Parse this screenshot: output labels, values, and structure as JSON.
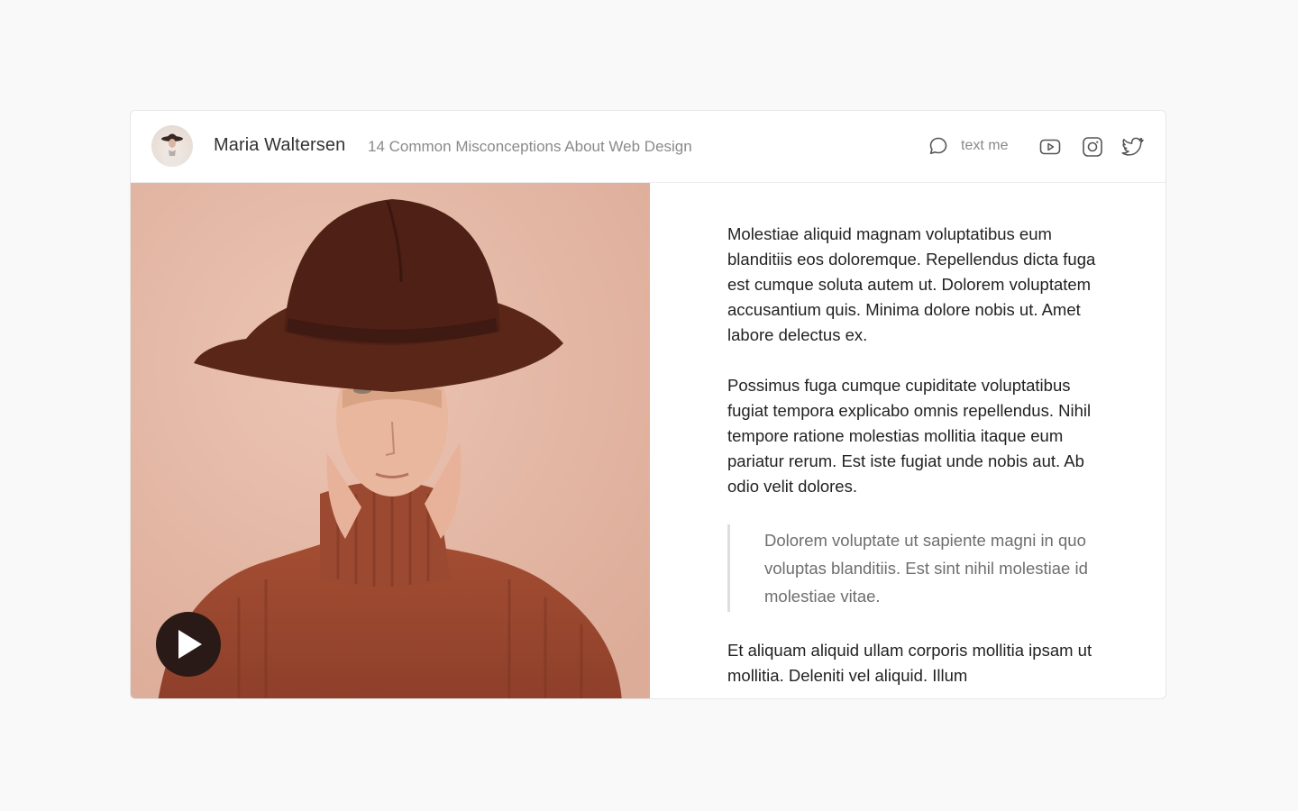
{
  "header": {
    "author_name": "Maria Waltersen",
    "post_title": "14 Common Misconceptions About Web Design",
    "text_me_label": "text me"
  },
  "icons": {
    "chat": "chat-bubble-icon",
    "youtube": "youtube-icon",
    "instagram": "instagram-icon",
    "twitter": "twitter-icon",
    "play": "play-icon"
  },
  "article": {
    "paragraphs": [
      "Molestiae aliquid magnam voluptatibus eum blanditiis eos doloremque. Repellendus dicta fuga est cumque soluta autem ut. Dolorem voluptatem accusantium quis. Minima dolore nobis ut. Amet labore delectus ex.",
      "Possimus fuga cumque cupiditate voluptatibus fugiat tempora explicabo omnis repellendus. Nihil tempore ratione molestias mollitia itaque eum pariatur rerum. Est iste fugiat unde nobis aut. Ab odio velit dolores."
    ],
    "quote": "Dolorem voluptate ut sapiente magni in quo voluptas blanditiis. Est sint nihil molestiae id molestiae vitae.",
    "after_quote": "Et aliquam aliquid ullam corporis mollitia ipsam ut mollitia. Deleniti vel aliquid. Illum"
  },
  "colors": {
    "page_background": "#f9f9f9",
    "card_background": "#ffffff",
    "photo_background": "#e6b8a4",
    "play_button": "#2a1a17"
  }
}
